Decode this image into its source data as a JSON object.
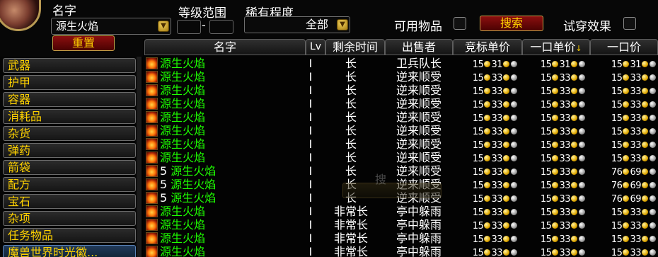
{
  "filters": {
    "name_label": "名字",
    "name_value": "源生火焰",
    "level_label": "等级范围",
    "level_dash": "-",
    "rarity_label": "稀有程度",
    "rarity_value": "全部",
    "usable_label": "可用物品",
    "search_button": "搜索",
    "preview_label": "试穿效果",
    "reset_button": "重置"
  },
  "categories": [
    "武器",
    "护甲",
    "容器",
    "消耗品",
    "杂货",
    "弹药",
    "箭袋",
    "配方",
    "宝石",
    "杂项",
    "任务物品",
    "魔兽世界时光徽..."
  ],
  "selected_category_index": 11,
  "columns": {
    "name": "名字",
    "level": "Lv",
    "time": "剩余时间",
    "seller": "出售者",
    "bid": "竞标单价",
    "buyout_unit": "一口单价",
    "buyout": "一口价"
  },
  "ghost_text": "搜",
  "rows": [
    {
      "qty": "",
      "name": "源生火焰",
      "lv": "I",
      "time": "长",
      "seller": "卫兵队长",
      "bid_g": "15",
      "bid_s": "31",
      "unit_g": "15",
      "unit_s": "31",
      "buy_g": "15",
      "buy_s": "31"
    },
    {
      "qty": "",
      "name": "源生火焰",
      "lv": "I",
      "time": "长",
      "seller": "逆来顺受",
      "bid_g": "15",
      "bid_s": "33",
      "unit_g": "15",
      "unit_s": "33",
      "buy_g": "15",
      "buy_s": "33"
    },
    {
      "qty": "",
      "name": "源生火焰",
      "lv": "I",
      "time": "长",
      "seller": "逆来顺受",
      "bid_g": "15",
      "bid_s": "33",
      "unit_g": "15",
      "unit_s": "33",
      "buy_g": "15",
      "buy_s": "33"
    },
    {
      "qty": "",
      "name": "源生火焰",
      "lv": "I",
      "time": "长",
      "seller": "逆来顺受",
      "bid_g": "15",
      "bid_s": "33",
      "unit_g": "15",
      "unit_s": "33",
      "buy_g": "15",
      "buy_s": "33"
    },
    {
      "qty": "",
      "name": "源生火焰",
      "lv": "I",
      "time": "长",
      "seller": "逆来顺受",
      "bid_g": "15",
      "bid_s": "33",
      "unit_g": "15",
      "unit_s": "33",
      "buy_g": "15",
      "buy_s": "33"
    },
    {
      "qty": "",
      "name": "源生火焰",
      "lv": "I",
      "time": "长",
      "seller": "逆来顺受",
      "bid_g": "15",
      "bid_s": "33",
      "unit_g": "15",
      "unit_s": "33",
      "buy_g": "15",
      "buy_s": "33"
    },
    {
      "qty": "",
      "name": "源生火焰",
      "lv": "I",
      "time": "长",
      "seller": "逆来顺受",
      "bid_g": "15",
      "bid_s": "33",
      "unit_g": "15",
      "unit_s": "33",
      "buy_g": "15",
      "buy_s": "33"
    },
    {
      "qty": "",
      "name": "源生火焰",
      "lv": "I",
      "time": "长",
      "seller": "逆来顺受",
      "bid_g": "15",
      "bid_s": "33",
      "unit_g": "15",
      "unit_s": "33",
      "buy_g": "15",
      "buy_s": "33"
    },
    {
      "qty": "5",
      "name": "源生火焰",
      "lv": "I",
      "time": "长",
      "seller": "逆来顺受",
      "bid_g": "15",
      "bid_s": "33",
      "unit_g": "15",
      "unit_s": "33",
      "buy_g": "76",
      "buy_s": "69"
    },
    {
      "qty": "5",
      "name": "源生火焰",
      "lv": "I",
      "time": "长",
      "seller": "逆来顺受",
      "bid_g": "15",
      "bid_s": "33",
      "unit_g": "15",
      "unit_s": "33",
      "buy_g": "76",
      "buy_s": "69"
    },
    {
      "qty": "5",
      "name": "源生火焰",
      "lv": "I",
      "time": "长",
      "seller": "逆来顺受",
      "bid_g": "15",
      "bid_s": "33",
      "unit_g": "15",
      "unit_s": "33",
      "buy_g": "76",
      "buy_s": "69"
    },
    {
      "qty": "",
      "name": "源生火焰",
      "lv": "I",
      "time": "非常长",
      "seller": "亭中躲雨",
      "bid_g": "15",
      "bid_s": "33",
      "unit_g": "15",
      "unit_s": "33",
      "buy_g": "15",
      "buy_s": "33"
    },
    {
      "qty": "",
      "name": "源生火焰",
      "lv": "I",
      "time": "非常长",
      "seller": "亭中躲雨",
      "bid_g": "15",
      "bid_s": "33",
      "unit_g": "15",
      "unit_s": "33",
      "buy_g": "15",
      "buy_s": "33"
    },
    {
      "qty": "",
      "name": "源生火焰",
      "lv": "I",
      "time": "非常长",
      "seller": "亭中躲雨",
      "bid_g": "15",
      "bid_s": "33",
      "unit_g": "15",
      "unit_s": "33",
      "buy_g": "15",
      "buy_s": "33"
    },
    {
      "qty": "",
      "name": "源生火焰",
      "lv": "I",
      "time": "非常长",
      "seller": "亭中躲雨",
      "bid_g": "15",
      "bid_s": "33",
      "unit_g": "15",
      "unit_s": "33",
      "buy_g": "15",
      "buy_s": "33"
    }
  ],
  "colors": {
    "item_name": "#1eff00",
    "category_text": "#ffd200",
    "button_red": "#8c0f0f"
  }
}
